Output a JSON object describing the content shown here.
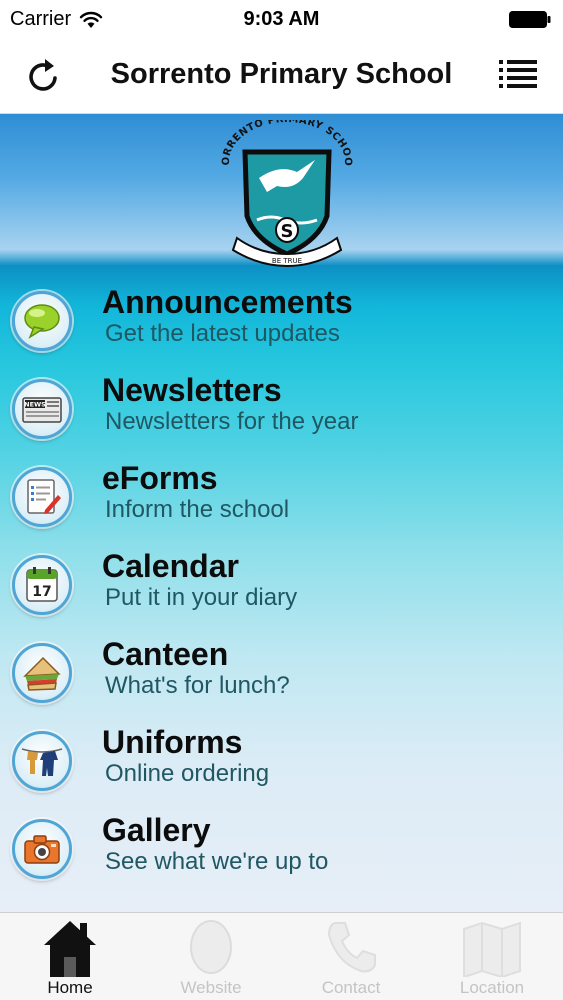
{
  "status_bar": {
    "carrier": "Carrier",
    "time": "9:03 AM"
  },
  "nav_bar": {
    "title": "Sorrento Primary School"
  },
  "logo": {
    "arc_text": "SORRENTO PRIMARY SCHOOL",
    "letter": "S",
    "motto": "BE TRUE"
  },
  "menu": [
    {
      "title": "Announcements",
      "subtitle": "Get the latest updates",
      "icon": "speech-bubble-icon"
    },
    {
      "title": "Newsletters",
      "subtitle": "Newsletters for the year",
      "icon": "newspaper-icon",
      "icon_text": "NEWS"
    },
    {
      "title": "eForms",
      "subtitle": "Inform the school",
      "icon": "form-icon"
    },
    {
      "title": "Calendar",
      "subtitle": "Put it in your diary",
      "icon": "calendar-icon",
      "icon_text": "17"
    },
    {
      "title": "Canteen",
      "subtitle": "What's for lunch?",
      "icon": "sandwich-icon"
    },
    {
      "title": "Uniforms",
      "subtitle": "Online ordering",
      "icon": "clothesline-icon"
    },
    {
      "title": "Gallery",
      "subtitle": "See what we're up to",
      "icon": "camera-icon"
    }
  ],
  "tabs": [
    {
      "label": "Home",
      "icon": "house-icon",
      "active": true
    },
    {
      "label": "Website",
      "icon": "globe-icon",
      "active": false
    },
    {
      "label": "Contact",
      "icon": "phone-icon",
      "active": false
    },
    {
      "label": "Location",
      "icon": "map-icon",
      "active": false
    }
  ],
  "colors": {
    "accent_ring": "#4fa6d6",
    "shield_teal": "#1e9aa5",
    "subtitle_text": "#1f5763"
  }
}
